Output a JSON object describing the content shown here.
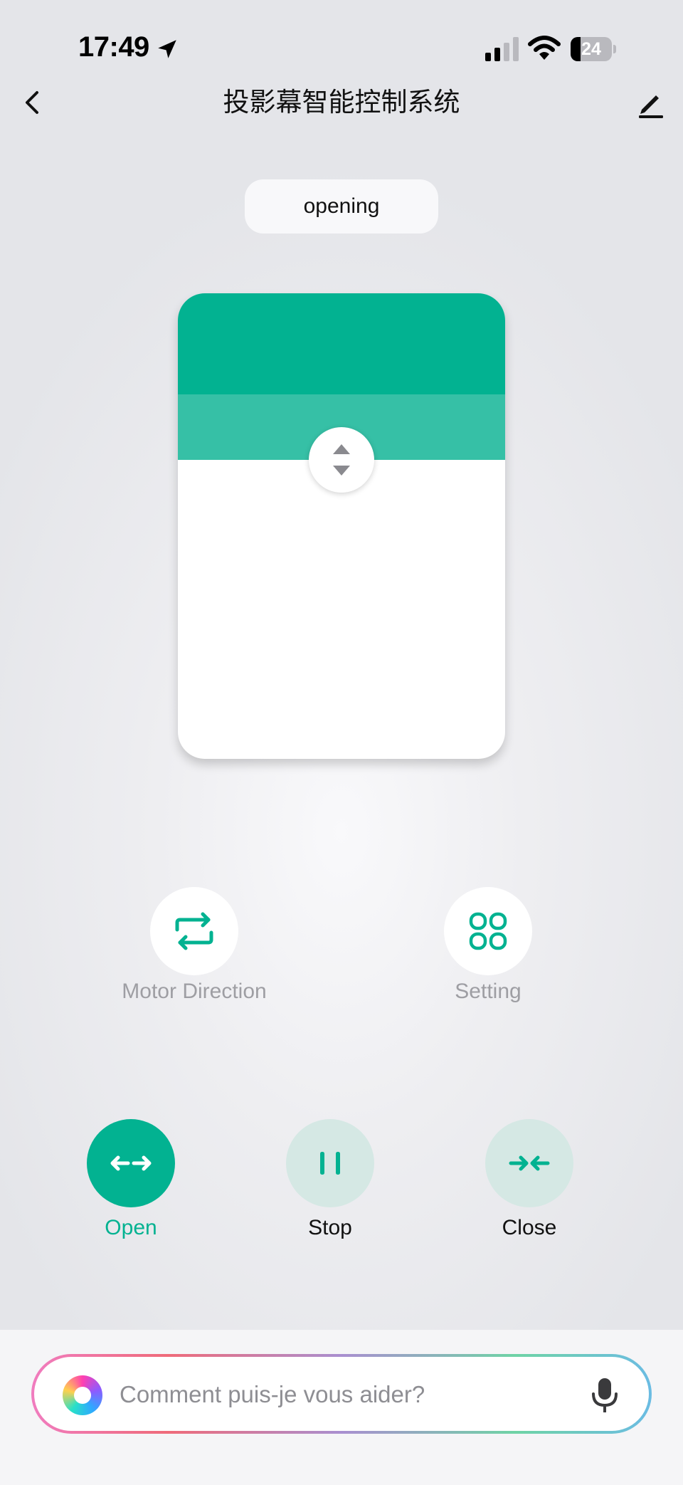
{
  "status_bar": {
    "time": "17:49",
    "battery_percent": "24",
    "battery_level": 0.24,
    "icons": [
      "location-arrow-icon",
      "cellular-signal-icon",
      "wifi-icon",
      "battery-icon"
    ]
  },
  "header": {
    "title": "投影幕智能控制系统",
    "back_icon": "chevron-left-icon",
    "edit_icon": "pencil-icon"
  },
  "device": {
    "state_label": "opening",
    "handle_icon": "up-down-arrows-icon"
  },
  "features": [
    {
      "label": "Motor Direction",
      "icon": "swap-arrows-icon"
    },
    {
      "label": "Setting",
      "icon": "grid-icon"
    }
  ],
  "actions": [
    {
      "label": "Open",
      "icon": "arrows-outward-icon",
      "active": true
    },
    {
      "label": "Stop",
      "icon": "pause-icon",
      "active": false
    },
    {
      "label": "Close",
      "icon": "arrows-inward-icon",
      "active": false
    }
  ],
  "assistant": {
    "placeholder": "Comment puis-je vous aider?",
    "logo_icon": "assistant-logo",
    "mic_icon": "microphone-icon"
  },
  "colors": {
    "accent": "#02B291",
    "accent_light": "#36C0A6",
    "action_bg": "#D5E8E4"
  }
}
